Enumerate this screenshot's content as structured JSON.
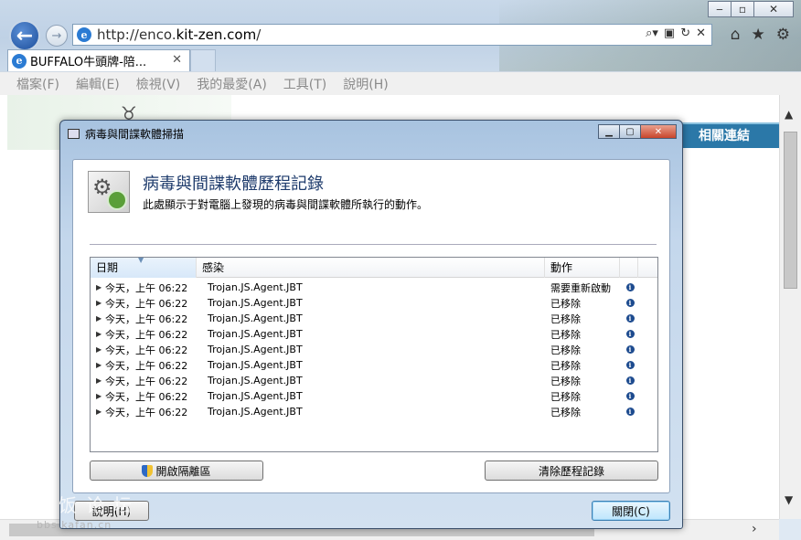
{
  "browser": {
    "url_prefix": "http://enco.",
    "url_domain": "kit-zen.com",
    "url_suffix": "/",
    "tab_title": "BUFFALO牛頭牌-陪...",
    "menu": [
      "檔案(F)",
      "編輯(E)",
      "檢視(V)",
      "我的最愛(A)",
      "工具(T)",
      "說明(H)"
    ]
  },
  "page": {
    "related_links": "相關連結"
  },
  "dialog": {
    "window_title": "病毒與間諜軟體掃描",
    "heading": "病毒與間諜軟體歷程記錄",
    "description": "此處顯示于對電腦上發現的病毒與間諜軟體所執行的動作。",
    "columns": {
      "date": "日期",
      "infection": "感染",
      "action": "動作"
    },
    "rows": [
      {
        "date": "今天，上午 06:22",
        "threat": "Trojan.JS.Agent.JBT",
        "action": "需要重新啟動"
      },
      {
        "date": "今天，上午 06:22",
        "threat": "Trojan.JS.Agent.JBT",
        "action": "已移除"
      },
      {
        "date": "今天，上午 06:22",
        "threat": "Trojan.JS.Agent.JBT",
        "action": "已移除"
      },
      {
        "date": "今天，上午 06:22",
        "threat": "Trojan.JS.Agent.JBT",
        "action": "已移除"
      },
      {
        "date": "今天，上午 06:22",
        "threat": "Trojan.JS.Agent.JBT",
        "action": "已移除"
      },
      {
        "date": "今天，上午 06:22",
        "threat": "Trojan.JS.Agent.JBT",
        "action": "已移除"
      },
      {
        "date": "今天，上午 06:22",
        "threat": "Trojan.JS.Agent.JBT",
        "action": "已移除"
      },
      {
        "date": "今天，上午 06:22",
        "threat": "Trojan.JS.Agent.JBT",
        "action": "已移除"
      },
      {
        "date": "今天，上午 06:22",
        "threat": "Trojan.JS.Agent.JBT",
        "action": "已移除"
      }
    ],
    "btn_quarantine": "開啟隔離區",
    "btn_clear": "清除歷程記錄",
    "btn_help": "說明(H)",
    "btn_close": "關閉(C)"
  },
  "watermark": {
    "text": "卡饭论坛",
    "url": "bbs.kafan.cn"
  }
}
